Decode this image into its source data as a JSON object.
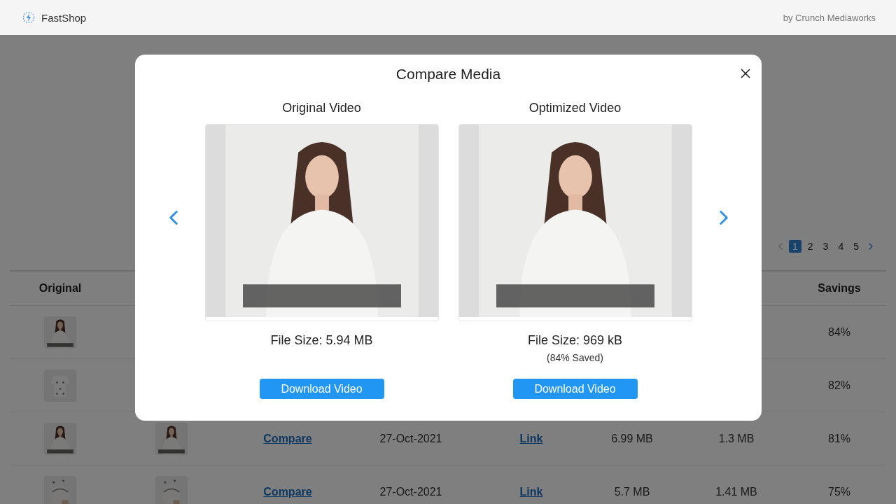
{
  "header": {
    "brand": "FastShop",
    "credit": "by Crunch Mediaworks"
  },
  "pagination": {
    "prev": {
      "disabled": true
    },
    "next": {
      "disabled": false
    },
    "pages": [
      {
        "label": "1",
        "selected": true
      },
      {
        "label": "2",
        "selected": false
      },
      {
        "label": "3",
        "selected": false
      },
      {
        "label": "4",
        "selected": false
      },
      {
        "label": "5",
        "selected": false
      }
    ]
  },
  "table": {
    "header": {
      "original": "Original",
      "savings": "Savings"
    },
    "rows": [
      {
        "savings": "84%"
      },
      {
        "savings": "82%"
      },
      {
        "compare": "Compare",
        "date": "27-Oct-2021",
        "link": "Link",
        "original_size": "6.99 MB",
        "optimized_size": "1.3 MB",
        "savings": "81%"
      },
      {
        "compare": "Compare",
        "date": "27-Oct-2021",
        "link": "Link",
        "original_size": "5.7 MB",
        "optimized_size": "1.41 MB",
        "savings": "75%"
      }
    ]
  },
  "modal": {
    "title": "Compare Media",
    "panels": [
      {
        "heading": "Original Video",
        "file_size": "File Size: 5.94 MB",
        "button": "Download Video"
      },
      {
        "heading": "Optimized Video",
        "file_size": "File Size: 969 kB",
        "saved": "(84% Saved)",
        "button": "Download Video"
      }
    ]
  }
}
